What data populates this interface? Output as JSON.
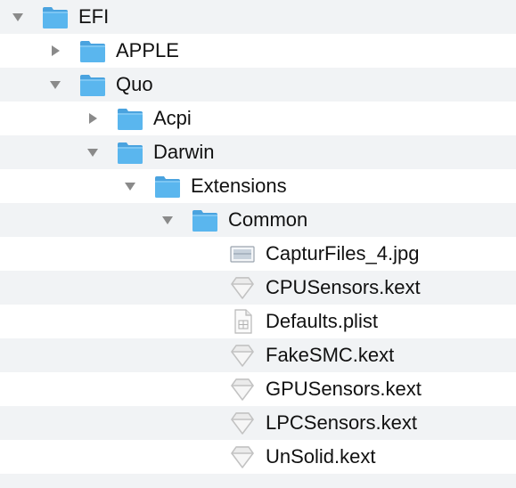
{
  "tree": {
    "rows": [
      {
        "label": "EFI",
        "kind": "folder",
        "level": 0,
        "disclosure": "expanded"
      },
      {
        "label": "APPLE",
        "kind": "folder",
        "level": 1,
        "disclosure": "collapsed"
      },
      {
        "label": "Quo",
        "kind": "folder",
        "level": 1,
        "disclosure": "expanded"
      },
      {
        "label": "Acpi",
        "kind": "folder",
        "level": 2,
        "disclosure": "collapsed"
      },
      {
        "label": "Darwin",
        "kind": "folder",
        "level": 2,
        "disclosure": "expanded"
      },
      {
        "label": "Extensions",
        "kind": "folder",
        "level": 3,
        "disclosure": "expanded"
      },
      {
        "label": "Common",
        "kind": "folder",
        "level": 4,
        "disclosure": "expanded"
      },
      {
        "label": "CapturFiles_4.jpg",
        "kind": "image-file",
        "level": 5,
        "disclosure": "none"
      },
      {
        "label": "CPUSensors.kext",
        "kind": "kext",
        "level": 5,
        "disclosure": "none"
      },
      {
        "label": "Defaults.plist",
        "kind": "plist",
        "level": 5,
        "disclosure": "none"
      },
      {
        "label": "FakeSMC.kext",
        "kind": "kext",
        "level": 5,
        "disclosure": "none"
      },
      {
        "label": "GPUSensors.kext",
        "kind": "kext",
        "level": 5,
        "disclosure": "none"
      },
      {
        "label": "LPCSensors.kext",
        "kind": "kext",
        "level": 5,
        "disclosure": "none"
      },
      {
        "label": "UnSolid.kext",
        "kind": "kext",
        "level": 5,
        "disclosure": "none"
      }
    ]
  },
  "icons": {
    "folder": "folder-icon",
    "image-file": "image-file-icon",
    "kext": "kext-icon",
    "plist": "plist-file-icon",
    "expanded": "disclosure-triangle-down-icon",
    "collapsed": "disclosure-triangle-right-icon"
  },
  "colors": {
    "folder_body": "#5ab6ee",
    "folder_tab": "#4aa3df",
    "stripe": "#f1f3f5",
    "triangle": "#8a8a8a",
    "text": "#111111"
  }
}
